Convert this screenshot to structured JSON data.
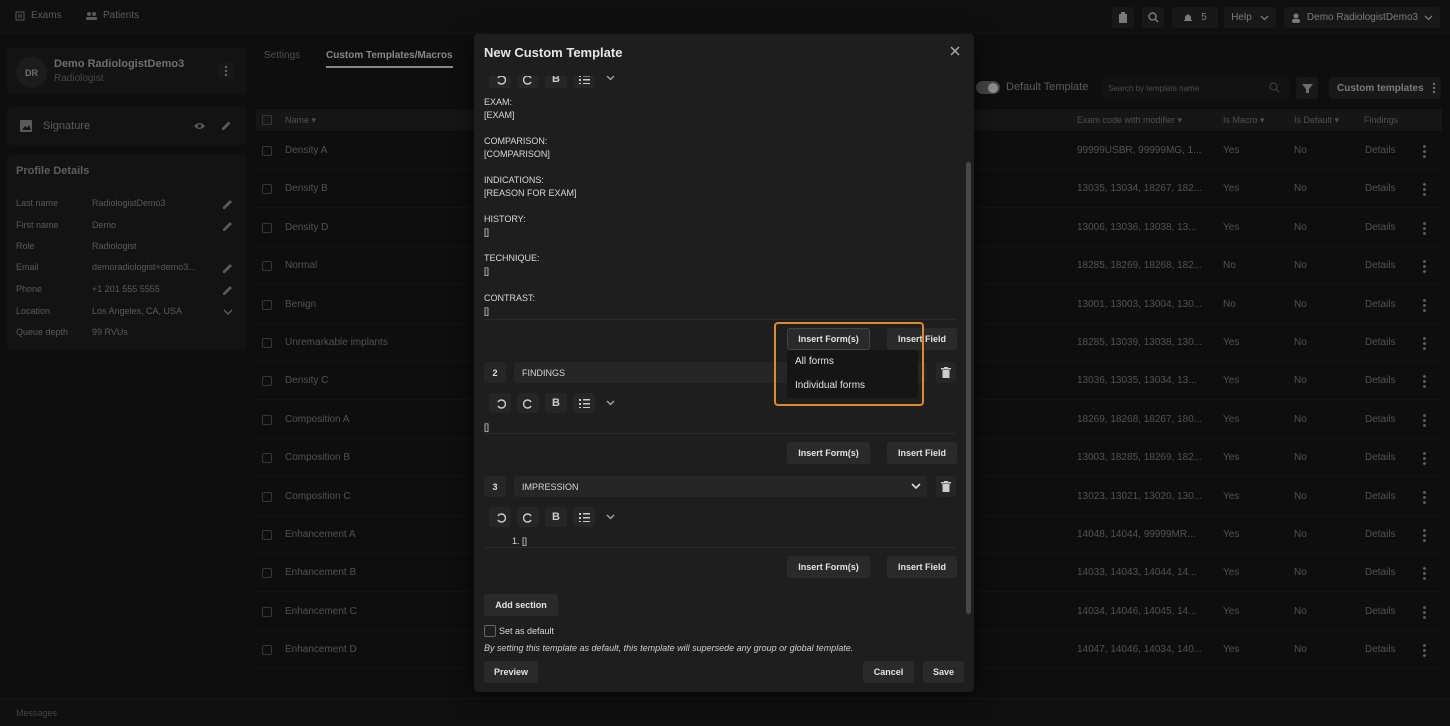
{
  "topbar": {
    "exams": "Exams",
    "patients": "Patients",
    "notification_count": "5",
    "help": "Help",
    "user": "Demo RadiologistDemo3"
  },
  "profile": {
    "initials": "DR",
    "name": "Demo RadiologistDemo3",
    "role": "Radiologist"
  },
  "signature": {
    "label": "Signature"
  },
  "details": {
    "title": "Profile Details",
    "rows": [
      {
        "label": "Last name",
        "value": "RadiologistDemo3",
        "icon": "pencil-icon"
      },
      {
        "label": "First name",
        "value": "Demo",
        "icon": "pencil-icon"
      },
      {
        "label": "Role",
        "value": "Radiologist",
        "icon": ""
      },
      {
        "label": "Email",
        "value": "demoradiologist+demo3...",
        "icon": "pencil-icon"
      },
      {
        "label": "Phone",
        "value": "+1 201 555 5555",
        "icon": "pencil-icon"
      },
      {
        "label": "Location",
        "value": "Los Angeles, CA, USA",
        "icon": "chevron-down-icon"
      },
      {
        "label": "Queue depth",
        "value": "99 RVUs",
        "icon": ""
      }
    ]
  },
  "tabs": {
    "settings": "Settings",
    "custom": "Custom Templates/Macros"
  },
  "toolbar": {
    "default_template": "Default Template",
    "search_placeholder": "Search by template name",
    "custom_templates": "Custom templates"
  },
  "table": {
    "headers": {
      "name": "Name",
      "exam_code": "Exam code with modifier",
      "is_macro": "Is Macro",
      "is_default": "Is Default",
      "findings": "Findings"
    },
    "rows": [
      {
        "name": "Density A",
        "code": "99999USBR, 99999MG, 1...",
        "macro": "Yes",
        "default": "No",
        "findings": "Details"
      },
      {
        "name": "Density B",
        "code": "13035, 13034, 18267, 182...",
        "macro": "Yes",
        "default": "No",
        "findings": "Details"
      },
      {
        "name": "Density D",
        "code": "13006, 13036, 13038, 13...",
        "macro": "Yes",
        "default": "No",
        "findings": "Details"
      },
      {
        "name": "Normal",
        "code": "18285, 18269, 18268, 182...",
        "macro": "No",
        "default": "No",
        "findings": "Details"
      },
      {
        "name": "Benign",
        "code": "13001, 13003, 13004, 130...",
        "macro": "No",
        "default": "No",
        "findings": "Details"
      },
      {
        "name": "Unremarkable implants",
        "code": "18285, 13039, 13038, 130...",
        "macro": "Yes",
        "default": "No",
        "findings": "Details"
      },
      {
        "name": "Density C",
        "code": "13036, 13035, 13034, 13...",
        "macro": "Yes",
        "default": "No",
        "findings": "Details"
      },
      {
        "name": "Composition A",
        "code": "18269, 18268, 18267, 180...",
        "macro": "Yes",
        "default": "No",
        "findings": "Details"
      },
      {
        "name": "Composition B",
        "code": "13003, 18285, 18269, 182...",
        "macro": "Yes",
        "default": "No",
        "findings": "Details"
      },
      {
        "name": "Composition C",
        "code": "13023, 13021, 13020, 130...",
        "macro": "Yes",
        "default": "No",
        "findings": "Details"
      },
      {
        "name": "Enhancement A",
        "code": "14048, 14044, 99999MR...",
        "macro": "Yes",
        "default": "No",
        "findings": "Details"
      },
      {
        "name": "Enhancement B",
        "code": "14033, 14043, 14044, 14...",
        "macro": "Yes",
        "default": "No",
        "findings": "Details"
      },
      {
        "name": "Enhancement C",
        "code": "14034, 14046, 14045, 14...",
        "macro": "Yes",
        "default": "No",
        "findings": "Details"
      },
      {
        "name": "Enhancement D",
        "code": "14047, 14046, 14034, 140...",
        "macro": "Yes",
        "default": "No",
        "findings": "Details"
      }
    ]
  },
  "modal": {
    "title": "New Custom Template",
    "body_lines": [
      "EXAM:",
      "[EXAM]",
      "COMPARISON:",
      "[COMPARISON]",
      "INDICATIONS:",
      "[REASON FOR EXAM]",
      "HISTORY:",
      "[]",
      "TECHNIQUE:",
      "[]",
      "CONTRAST:",
      "[]"
    ],
    "insert_forms": "Insert Form(s)",
    "insert_field": "Insert Field",
    "dropdown": [
      "All forms",
      "Individual forms"
    ],
    "sections": [
      {
        "num": "2",
        "name": "FINDINGS",
        "content": "[]"
      },
      {
        "num": "3",
        "name": "IMPRESSION",
        "content": "1. []"
      }
    ],
    "add_section": "Add section",
    "set_default": "Set as default",
    "default_note": "By setting this template as default, this template will supersede any group or global template.",
    "preview": "Preview",
    "cancel": "Cancel",
    "save": "Save"
  },
  "footer": {
    "messages": "Messages"
  }
}
